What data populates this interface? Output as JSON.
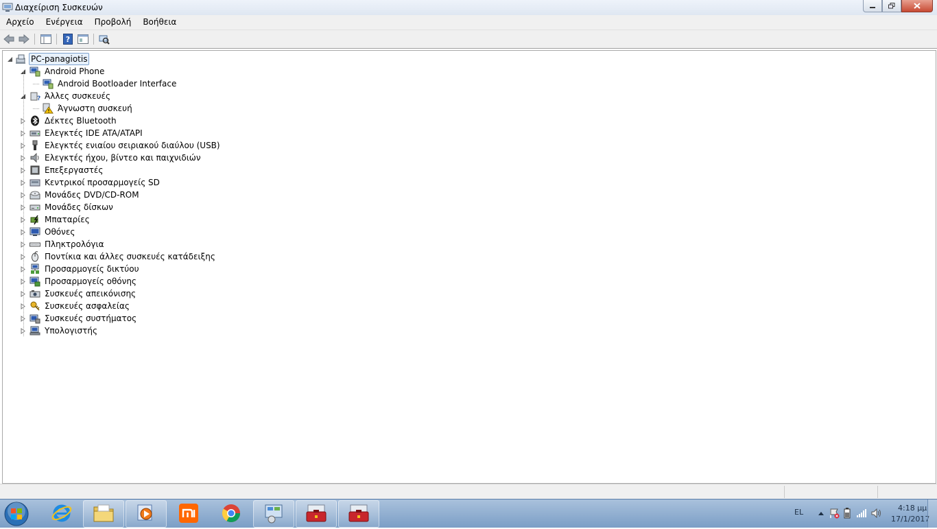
{
  "window": {
    "title": "Διαχείριση Συσκευών"
  },
  "menu": [
    "Αρχείο",
    "Ενέργεια",
    "Προβολή",
    "Βοήθεια"
  ],
  "tree": {
    "root": "PC-panagiotis",
    "items": [
      {
        "label": "Android Phone",
        "level": 1,
        "state": "expanded",
        "icon": "android-device-icon"
      },
      {
        "label": "Android Bootloader Interface",
        "level": 2,
        "state": "leaf",
        "icon": "android-device-icon"
      },
      {
        "label": "Άλλες συσκευές",
        "level": 1,
        "state": "expanded",
        "icon": "other-devices-icon"
      },
      {
        "label": "Άγνωστη συσκευή",
        "level": 2,
        "state": "leaf",
        "icon": "unknown-device-warning-icon"
      },
      {
        "label": "Δέκτες Bluetooth",
        "level": 1,
        "state": "collapsed",
        "icon": "bluetooth-icon"
      },
      {
        "label": "Ελεγκτές IDE ATA/ATAPI",
        "level": 1,
        "state": "collapsed",
        "icon": "ide-controller-icon"
      },
      {
        "label": "Ελεγκτές ενιαίου σειριακού διαύλου (USB)",
        "level": 1,
        "state": "collapsed",
        "icon": "usb-icon"
      },
      {
        "label": "Ελεγκτές ήχου, βίντεο και παιχνιδιών",
        "level": 1,
        "state": "collapsed",
        "icon": "speaker-icon"
      },
      {
        "label": "Επεξεργαστές",
        "level": 1,
        "state": "collapsed",
        "icon": "processor-icon"
      },
      {
        "label": "Κεντρικοί προσαρμογείς SD",
        "level": 1,
        "state": "collapsed",
        "icon": "sd-host-icon"
      },
      {
        "label": "Μονάδες DVD/CD-ROM",
        "level": 1,
        "state": "collapsed",
        "icon": "dvd-drive-icon"
      },
      {
        "label": "Μονάδες δίσκων",
        "level": 1,
        "state": "collapsed",
        "icon": "disk-drive-icon"
      },
      {
        "label": "Μπαταρίες",
        "level": 1,
        "state": "collapsed",
        "icon": "battery-icon"
      },
      {
        "label": "Οθόνες",
        "level": 1,
        "state": "collapsed",
        "icon": "monitor-icon"
      },
      {
        "label": "Πληκτρολόγια",
        "level": 1,
        "state": "collapsed",
        "icon": "keyboard-icon"
      },
      {
        "label": "Ποντίκια και άλλες συσκευές κατάδειξης",
        "level": 1,
        "state": "collapsed",
        "icon": "mouse-icon"
      },
      {
        "label": "Προσαρμογείς δικτύου",
        "level": 1,
        "state": "collapsed",
        "icon": "network-adapter-icon"
      },
      {
        "label": "Προσαρμογείς οθόνης",
        "level": 1,
        "state": "collapsed",
        "icon": "display-adapter-icon"
      },
      {
        "label": "Συσκευές απεικόνισης",
        "level": 1,
        "state": "collapsed",
        "icon": "imaging-device-icon"
      },
      {
        "label": "Συσκευές ασφαλείας",
        "level": 1,
        "state": "collapsed",
        "icon": "security-key-icon"
      },
      {
        "label": "Συσκευές συστήματος",
        "level": 1,
        "state": "collapsed",
        "icon": "system-devices-icon"
      },
      {
        "label": "Υπολογιστής",
        "level": 1,
        "state": "collapsed",
        "icon": "computer-icon"
      }
    ]
  },
  "taskbar": {
    "apps": [
      "internet-explorer-icon",
      "file-explorer-icon",
      "media-player-icon",
      "mi-app-icon",
      "chrome-icon",
      "control-panel-icon",
      "device-manager-icon",
      "device-manager-icon"
    ]
  },
  "tray": {
    "language": "EL",
    "time": "4:18 μμ",
    "date": "17/1/2017"
  }
}
